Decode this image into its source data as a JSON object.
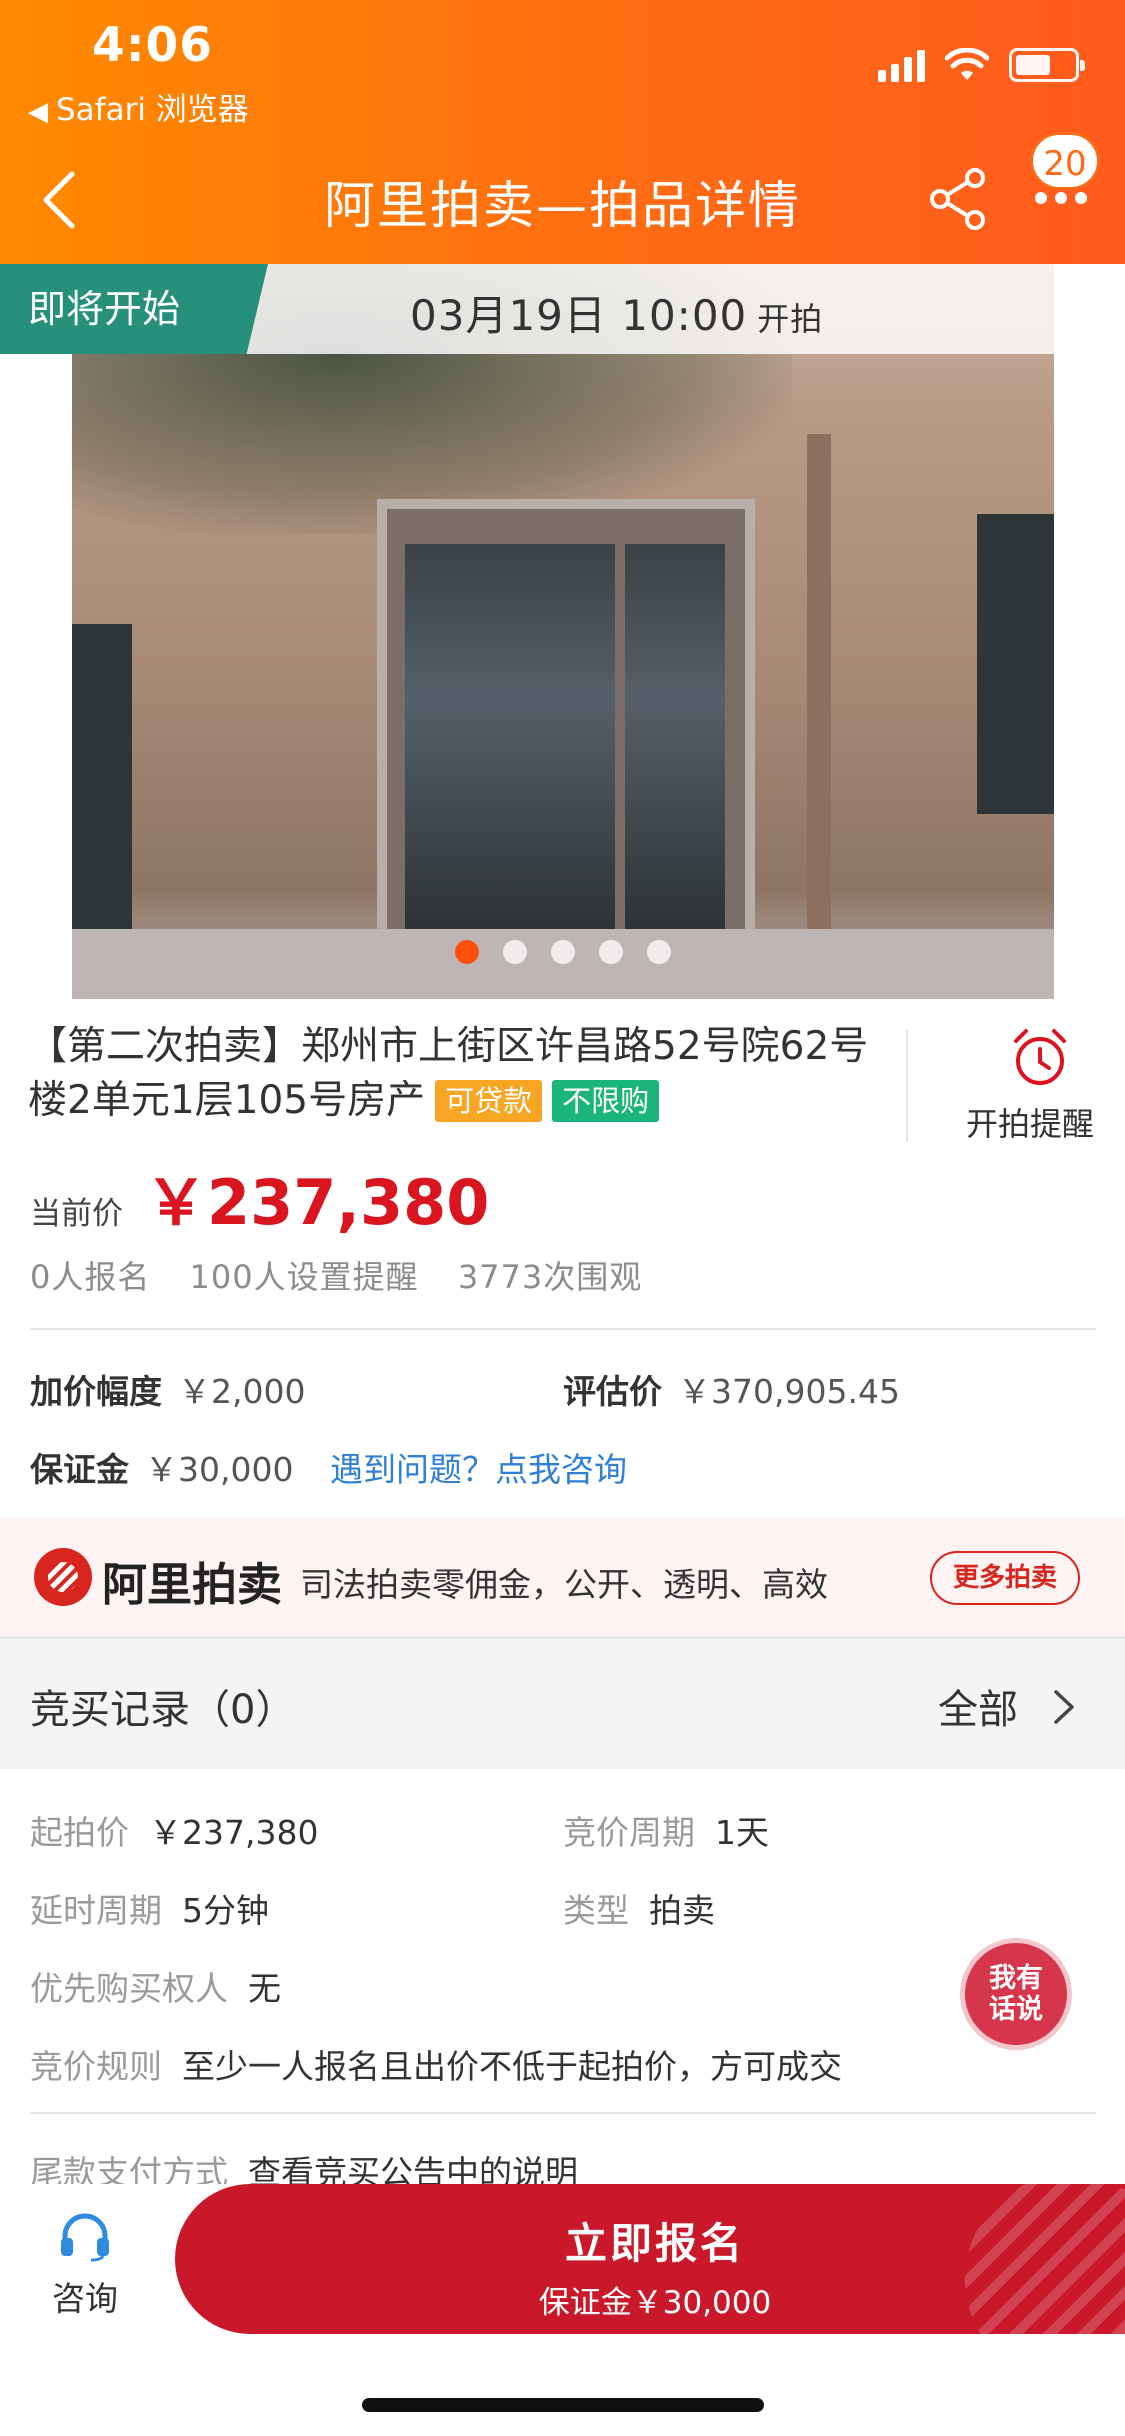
{
  "status_bar": {
    "time": "4:06",
    "back_app": "Safari 浏览器"
  },
  "nav": {
    "title": "阿里拍卖—拍品详情",
    "badge_count": "20"
  },
  "banner": {
    "tag": "即将开始",
    "datetime": "03月19日 10:00",
    "suffix": "开拍"
  },
  "gallery": {
    "image_count": 5,
    "current_index": 0
  },
  "item": {
    "title": "【第二次拍卖】郑州市上街区许昌路52号院62号楼2单元1层105号房产",
    "tags": [
      "可贷款",
      "不限购"
    ],
    "reminder_label": "开拍提醒",
    "price_label": "当前价",
    "price": "￥237,380",
    "stats": [
      "0人报名",
      "100人设置提醒",
      "3773次围观"
    ]
  },
  "info": {
    "increment_label": "加价幅度",
    "increment_value": "￥2,000",
    "valuation_label": "评估价",
    "valuation_value": "￥370,905.45",
    "deposit_label": "保证金",
    "deposit_value": "￥30,000",
    "help_link": "遇到问题？点我咨询"
  },
  "brand": {
    "name": "阿里拍卖",
    "slogan": "司法拍卖零佣金，公开、透明、高效",
    "more_button": "更多拍卖"
  },
  "records": {
    "title": "竞买记录（0）",
    "all_label": "全部"
  },
  "details": {
    "start_price_label": "起拍价",
    "start_price": "￥237,380",
    "cycle_label": "竞价周期",
    "cycle": "1天",
    "delay_label": "延时周期",
    "delay": "5分钟",
    "type_label": "类型",
    "type": "拍卖",
    "priority_label": "优先购买权人",
    "priority": "无",
    "rule_label": "竞价规则",
    "rule": "至少一人报名且出价不低于起拍价，方可成交",
    "payment_label": "尾款支付方式",
    "payment": "查看竞买公告中的说明"
  },
  "chat_fab": {
    "line1": "我有",
    "line2": "话说"
  },
  "bottom_bar": {
    "consult_label": "咨询",
    "cta_main": "立即报名",
    "cta_sub": "保证金￥30,000"
  },
  "colors": {
    "header": "#ff7a0f",
    "price_red": "#d9151f",
    "cta": "#c9182a",
    "tag_green": "#27907a"
  }
}
